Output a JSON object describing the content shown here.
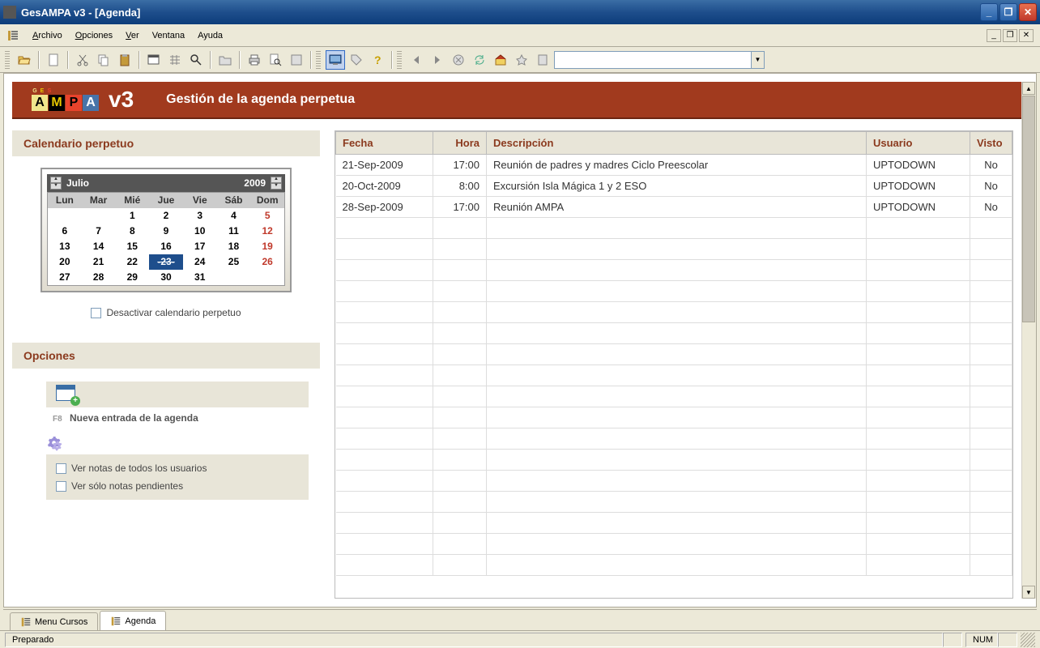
{
  "window": {
    "title": "GesAMPA v3 - [Agenda]"
  },
  "menu": {
    "archivo": "Archivo",
    "opciones": "Opciones",
    "ver": "Ver",
    "ventana": "Ventana",
    "ayuda": "Ayuda"
  },
  "banner": {
    "ges": [
      "G",
      "E",
      "S"
    ],
    "ampa": [
      "A",
      "M",
      "P",
      "A"
    ],
    "version": "v3",
    "title": "Gestión de la agenda perpetua"
  },
  "calendar": {
    "panel_title": "Calendario perpetuo",
    "month": "Julio",
    "year": "2009",
    "day_headers": [
      "Lun",
      "Mar",
      "Mié",
      "Jue",
      "Vie",
      "Sáb",
      "Dom"
    ],
    "weeks": [
      [
        "",
        "",
        "1",
        "2",
        "3",
        "4",
        "5"
      ],
      [
        "6",
        "7",
        "8",
        "9",
        "10",
        "11",
        "12"
      ],
      [
        "13",
        "14",
        "15",
        "16",
        "17",
        "18",
        "19"
      ],
      [
        "20",
        "21",
        "22",
        "23",
        "24",
        "25",
        "26"
      ],
      [
        "27",
        "28",
        "29",
        "30",
        "31",
        "",
        ""
      ]
    ],
    "selected_day": "23",
    "deactivate_label": "Desactivar calendario perpetuo"
  },
  "options": {
    "panel_title": "Opciones",
    "f8_hint": "F8",
    "new_entry": "Nueva entrada de la agenda",
    "view_all_users": "Ver notas de todos los usuarios",
    "view_pending": "Ver sólo notas pendientes"
  },
  "table": {
    "headers": {
      "fecha": "Fecha",
      "hora": "Hora",
      "descripcion": "Descripción",
      "usuario": "Usuario",
      "visto": "Visto"
    },
    "rows": [
      {
        "fecha": "21-Sep-2009",
        "hora": "17:00",
        "desc": "Reunión de padres y madres Ciclo Preescolar",
        "usuario": "UPTODOWN",
        "visto": "No"
      },
      {
        "fecha": "20-Oct-2009",
        "hora": "8:00",
        "desc": "Excursión Isla Mágica 1 y 2 ESO",
        "usuario": "UPTODOWN",
        "visto": "No"
      },
      {
        "fecha": "28-Sep-2009",
        "hora": "17:00",
        "desc": "Reunión AMPA",
        "usuario": "UPTODOWN",
        "visto": "No"
      }
    ]
  },
  "tabs": {
    "menu_cursos": "Menu Cursos",
    "agenda": "Agenda"
  },
  "statusbar": {
    "ready": "Preparado",
    "num": "NUM"
  }
}
